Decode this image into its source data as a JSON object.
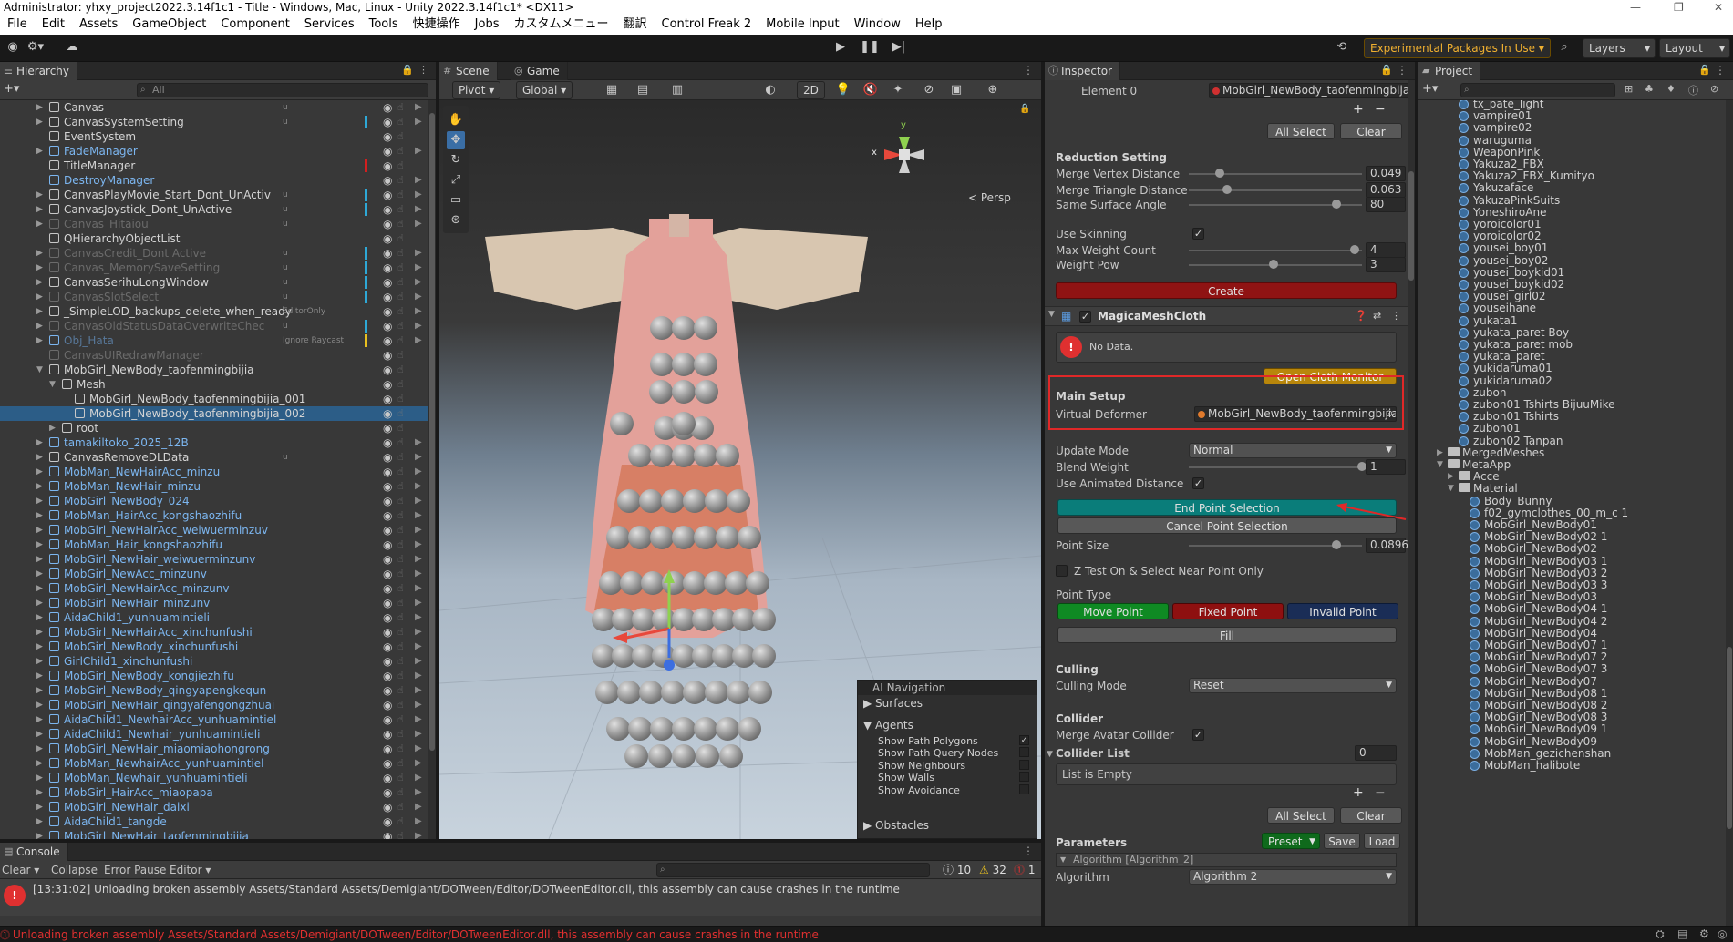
{
  "window": {
    "title": "Administrator: yhxy_project2022.3.14f1c1 - Title - Windows, Mac, Linux - Unity 2022.3.14f1c1* <DX11>"
  },
  "menu": [
    "File",
    "Edit",
    "Assets",
    "GameObject",
    "Component",
    "Services",
    "Tools",
    "快捷操作",
    "Jobs",
    "カスタムメニュー",
    "翻訳",
    "Control Freak 2",
    "Mobile Input",
    "Window",
    "Help"
  ],
  "toolbar": {
    "experimental": "Experimental Packages In Use ▾",
    "layers": "Layers",
    "layout": "Layout"
  },
  "hierarchy": {
    "tab": "Hierarchy",
    "search_placeholder": "All",
    "rows": [
      {
        "name": "Canvas",
        "indent": 0,
        "arrow": "▶",
        "color": "white",
        "u": "u",
        "bar": "",
        "rt": "▶"
      },
      {
        "name": "CanvasSystemSetting",
        "indent": 0,
        "arrow": "▶",
        "color": "white",
        "u": "u",
        "bar": "#2ea8d6",
        "rt": "▶"
      },
      {
        "name": "EventSystem",
        "indent": 0,
        "arrow": "",
        "color": "white",
        "u": "",
        "bar": "",
        "rt": ""
      },
      {
        "name": "FadeManager",
        "indent": 0,
        "arrow": "▶",
        "color": "blue",
        "u": "",
        "bar": "",
        "rt": "▶"
      },
      {
        "name": "TitleManager",
        "indent": 0,
        "arrow": "",
        "color": "white",
        "u": "",
        "bar": "#d21f1f",
        "rt": ""
      },
      {
        "name": "DestroyManager",
        "indent": 0,
        "arrow": "",
        "color": "blue",
        "u": "",
        "bar": "",
        "rt": "▶"
      },
      {
        "name": "CanvasPlayMovie_Start_Dont_UnActiv",
        "indent": 0,
        "arrow": "▶",
        "color": "white",
        "u": "u",
        "bar": "#2ea8d6",
        "rt": "▶"
      },
      {
        "name": "CanvasJoystick_Dont_UnActive",
        "indent": 0,
        "arrow": "▶",
        "color": "white",
        "u": "u",
        "bar": "#2ea8d6",
        "rt": "▶"
      },
      {
        "name": "Canvas_Hitaiou",
        "indent": 0,
        "arrow": "▶",
        "color": "dim",
        "u": "u",
        "bar": "",
        "rt": "▶"
      },
      {
        "name": "QHierarchyObjectList",
        "indent": 0,
        "arrow": "",
        "color": "white",
        "u": "",
        "bar": "",
        "rt": ""
      },
      {
        "name": "CanvasCredit_Dont Active",
        "indent": 0,
        "arrow": "▶",
        "color": "dim",
        "u": "u",
        "bar": "#2ea8d6",
        "rt": "▶"
      },
      {
        "name": "Canvas_MemorySaveSetting",
        "indent": 0,
        "arrow": "▶",
        "color": "dim",
        "u": "u",
        "bar": "#2ea8d6",
        "rt": "▶"
      },
      {
        "name": "CanvasSerihuLongWindow",
        "indent": 0,
        "arrow": "▶",
        "color": "white",
        "u": "u",
        "bar": "#2ea8d6",
        "rt": "▶"
      },
      {
        "name": "CanvasSlotSelect",
        "indent": 0,
        "arrow": "▶",
        "color": "dim",
        "u": "u",
        "bar": "#2ea8d6",
        "rt": "▶"
      },
      {
        "name": "_SimpleLOD_backups_delete_when_ready",
        "indent": 0,
        "arrow": "▶",
        "color": "white",
        "u": "EditorOnly",
        "bar": "",
        "rt": "▶"
      },
      {
        "name": "CanvasOldStatusDataOverwriteChec",
        "indent": 0,
        "arrow": "▶",
        "color": "dim",
        "u": "u",
        "bar": "#2ea8d6",
        "rt": "▶"
      },
      {
        "name": "Obj_Hata",
        "indent": 0,
        "arrow": "▶",
        "color": "dimblue",
        "u": "Ignore Raycast",
        "bar": "#e8c020",
        "rt": "▶"
      },
      {
        "name": "CanvasUIRedrawManager",
        "indent": 0,
        "arrow": "",
        "color": "dim",
        "u": "",
        "bar": "",
        "rt": ""
      },
      {
        "name": "MobGirl_NewBody_taofenmingbijia",
        "indent": 0,
        "arrow": "▼",
        "color": "white",
        "u": "",
        "bar": "",
        "rt": ""
      },
      {
        "name": "Mesh",
        "indent": 1,
        "arrow": "▼",
        "color": "white",
        "u": "",
        "bar": "",
        "rt": ""
      },
      {
        "name": "MobGirl_NewBody_taofenmingbijia_001",
        "indent": 2,
        "arrow": "",
        "color": "white",
        "u": "",
        "bar": "",
        "rt": ""
      },
      {
        "name": "MobGirl_NewBody_taofenmingbijia_002",
        "indent": 2,
        "arrow": "",
        "color": "white",
        "u": "",
        "bar": "",
        "rt": "",
        "selected": true
      },
      {
        "name": "root",
        "indent": 1,
        "arrow": "▶",
        "color": "white",
        "u": "",
        "bar": "",
        "rt": ""
      },
      {
        "name": "tamakiltoko_2025_12B",
        "indent": 0,
        "arrow": "▶",
        "color": "blue",
        "u": "",
        "bar": "",
        "rt": "▶"
      },
      {
        "name": "CanvasRemoveDLData",
        "indent": 0,
        "arrow": "▶",
        "color": "white",
        "u": "u",
        "bar": "",
        "rt": "▶"
      },
      {
        "name": "MobMan_NewHairAcc_minzu",
        "indent": 0,
        "arrow": "▶",
        "color": "blue",
        "u": "",
        "bar": "",
        "rt": "▶"
      },
      {
        "name": "MobMan_NewHair_minzu",
        "indent": 0,
        "arrow": "▶",
        "color": "blue",
        "u": "",
        "bar": "",
        "rt": "▶"
      },
      {
        "name": "MobGirl_NewBody_024",
        "indent": 0,
        "arrow": "▶",
        "color": "blue",
        "u": "",
        "bar": "",
        "rt": "▶"
      },
      {
        "name": "MobMan_HairAcc_kongshaozhifu",
        "indent": 0,
        "arrow": "▶",
        "color": "blue",
        "u": "",
        "bar": "",
        "rt": "▶"
      },
      {
        "name": "MobGirl_NewHairAcc_weiwuerminzuv",
        "indent": 0,
        "arrow": "▶",
        "color": "blue",
        "u": "",
        "bar": "",
        "rt": "▶"
      },
      {
        "name": "MobMan_Hair_kongshaozhifu",
        "indent": 0,
        "arrow": "▶",
        "color": "blue",
        "u": "",
        "bar": "",
        "rt": "▶"
      },
      {
        "name": "MobGirl_NewHair_weiwuerminzunv",
        "indent": 0,
        "arrow": "▶",
        "color": "blue",
        "u": "",
        "bar": "",
        "rt": "▶"
      },
      {
        "name": "MobGirl_NewAcc_minzunv",
        "indent": 0,
        "arrow": "▶",
        "color": "blue",
        "u": "",
        "bar": "",
        "rt": "▶"
      },
      {
        "name": "MobGirl_NewHairAcc_minzunv",
        "indent": 0,
        "arrow": "▶",
        "color": "blue",
        "u": "",
        "bar": "",
        "rt": "▶"
      },
      {
        "name": "MobGirl_NewHair_minzunv",
        "indent": 0,
        "arrow": "▶",
        "color": "blue",
        "u": "",
        "bar": "",
        "rt": "▶"
      },
      {
        "name": "AidaChild1_yunhuamintieli",
        "indent": 0,
        "arrow": "▶",
        "color": "blue",
        "u": "",
        "bar": "",
        "rt": "▶"
      },
      {
        "name": "MobGirl_NewHairAcc_xinchunfushi",
        "indent": 0,
        "arrow": "▶",
        "color": "blue",
        "u": "",
        "bar": "",
        "rt": "▶"
      },
      {
        "name": "MobGirl_NewBody_xinchunfushi",
        "indent": 0,
        "arrow": "▶",
        "color": "blue",
        "u": "",
        "bar": "",
        "rt": "▶"
      },
      {
        "name": "GirlChild1_xinchunfushi",
        "indent": 0,
        "arrow": "▶",
        "color": "blue",
        "u": "",
        "bar": "",
        "rt": "▶"
      },
      {
        "name": "MobGirl_NewBody_kongjiezhifu",
        "indent": 0,
        "arrow": "▶",
        "color": "blue",
        "u": "",
        "bar": "",
        "rt": "▶"
      },
      {
        "name": "MobGirl_NewBody_qingyapengkequn",
        "indent": 0,
        "arrow": "▶",
        "color": "blue",
        "u": "",
        "bar": "",
        "rt": "▶"
      },
      {
        "name": "MobGirl_NewHair_qingyafengongzhuai",
        "indent": 0,
        "arrow": "▶",
        "color": "blue",
        "u": "",
        "bar": "",
        "rt": "▶"
      },
      {
        "name": "AidaChild1_NewhairAcc_yunhuamintiel",
        "indent": 0,
        "arrow": "▶",
        "color": "blue",
        "u": "",
        "bar": "",
        "rt": "▶"
      },
      {
        "name": "AidaChild1_Newhair_yunhuamintieli",
        "indent": 0,
        "arrow": "▶",
        "color": "blue",
        "u": "",
        "bar": "",
        "rt": "▶"
      },
      {
        "name": "MobGirl_NewHair_miaomiaohongrong",
        "indent": 0,
        "arrow": "▶",
        "color": "blue",
        "u": "",
        "bar": "",
        "rt": "▶"
      },
      {
        "name": "MobMan_NewhairAcc_yunhuamintiel",
        "indent": 0,
        "arrow": "▶",
        "color": "blue",
        "u": "",
        "bar": "",
        "rt": "▶"
      },
      {
        "name": "MobMan_Newhair_yunhuamintieli",
        "indent": 0,
        "arrow": "▶",
        "color": "blue",
        "u": "",
        "bar": "",
        "rt": "▶"
      },
      {
        "name": "MobGirl_HairAcc_miaopapa",
        "indent": 0,
        "arrow": "▶",
        "color": "blue",
        "u": "",
        "bar": "",
        "rt": "▶"
      },
      {
        "name": "MobGirl_NewHair_daixi",
        "indent": 0,
        "arrow": "▶",
        "color": "blue",
        "u": "",
        "bar": "",
        "rt": "▶"
      },
      {
        "name": "AidaChild1_tangde",
        "indent": 0,
        "arrow": "▶",
        "color": "blue",
        "u": "",
        "bar": "",
        "rt": "▶"
      },
      {
        "name": "MobGirl_NewHair_taofenmingbijia",
        "indent": 0,
        "arrow": "▶",
        "color": "blue",
        "u": "",
        "bar": "",
        "rt": "▶"
      }
    ]
  },
  "scene": {
    "tab_scene": "Scene",
    "tab_game": "Game",
    "pivot": "Pivot",
    "global": "Global",
    "mode_2d": "2D",
    "persp": "< Persp",
    "gizmo_x": "x",
    "gizmo_y": "y",
    "ai_nav": {
      "title": "AI Navigation",
      "surfaces": "Surfaces",
      "agents": "Agents",
      "items": [
        "Show Path Polygons",
        "Show Path Query Nodes",
        "Show Neighbours",
        "Show Walls",
        "Show Avoidance"
      ],
      "checked_item": "✓",
      "obstacles": "Obstacles"
    }
  },
  "inspector": {
    "tab": "Inspector",
    "element0_label": "Element 0",
    "element0_value": "MobGirl_NewBody_taofenmingbija",
    "all_select": "All Select",
    "clear": "Clear",
    "reduction_title": "Reduction Setting",
    "merge_vertex": {
      "label": "Merge Vertex Distance",
      "value": "0.049",
      "frac": 0.18
    },
    "merge_triangle": {
      "label": "Merge Triangle Distance",
      "value": "0.063",
      "frac": 0.22
    },
    "same_surface": {
      "label": "Same Surface Angle",
      "value": "80",
      "frac": 0.85
    },
    "use_skinning": "Use Skinning",
    "max_weight": {
      "label": "Max Weight Count",
      "value": "4",
      "frac": 0.96
    },
    "weight_pow": {
      "label": "Weight Pow",
      "value": "3",
      "frac": 0.49
    },
    "create": "Create",
    "component_title": "MagicaMeshCloth",
    "no_data": "No Data.",
    "open_monitor": "Open Cloth Monitor",
    "main_setup": "Main Setup",
    "virtual_deformer_label": "Virtual Deformer",
    "virtual_deformer_value": "MobGirl_NewBody_taofenmingbijia_(",
    "update_mode_label": "Update Mode",
    "update_mode_value": "Normal",
    "blend_weight": {
      "label": "Blend Weight",
      "value": "1",
      "frac": 1.0
    },
    "use_animated": "Use Animated Distance",
    "end_point": "End Point Selection",
    "cancel_point": "Cancel Point Selection",
    "point_size": {
      "label": "Point Size",
      "value": "0.0896",
      "frac": 0.85
    },
    "z_test": "Z Test On & Select Near Point Only",
    "point_type": "Point Type",
    "move_point": "Move Point",
    "fixed_point": "Fixed Point",
    "invalid_point": "Invalid Point",
    "fill": "Fill",
    "culling_title": "Culling",
    "culling_mode_label": "Culling Mode",
    "culling_mode_value": "Reset",
    "collider_title": "Collider",
    "merge_avatar": "Merge Avatar Collider",
    "collider_list": "Collider List",
    "collider_count": "0",
    "list_empty": "List is Empty",
    "parameters": "Parameters",
    "preset": "Preset",
    "save": "Save",
    "load": "Load",
    "algorithm": "Algorithm [Algorithm_2]",
    "algorithm_row": "Algorithm",
    "algorithm_value": "Algorithm 2",
    "plus": "+",
    "minus": "−"
  },
  "project": {
    "tab": "Project",
    "rows": [
      {
        "name": "tx_pate_light",
        "indent": 2,
        "type": "asset"
      },
      {
        "name": "vampire01",
        "indent": 2,
        "type": "asset"
      },
      {
        "name": "vampire02",
        "indent": 2,
        "type": "asset"
      },
      {
        "name": "waruguma",
        "indent": 2,
        "type": "asset"
      },
      {
        "name": "WeaponPink",
        "indent": 2,
        "type": "asset"
      },
      {
        "name": "Yakuza2_FBX",
        "indent": 2,
        "type": "asset"
      },
      {
        "name": "Yakuza2_FBX_Kumityo",
        "indent": 2,
        "type": "asset"
      },
      {
        "name": "Yakuzaface",
        "indent": 2,
        "type": "asset"
      },
      {
        "name": "YakuzaPinkSuits",
        "indent": 2,
        "type": "asset"
      },
      {
        "name": "YoneshiroAne",
        "indent": 2,
        "type": "asset"
      },
      {
        "name": "yoroicolor01",
        "indent": 2,
        "type": "asset"
      },
      {
        "name": "yoroicolor02",
        "indent": 2,
        "type": "asset"
      },
      {
        "name": "yousei_boy01",
        "indent": 2,
        "type": "asset"
      },
      {
        "name": "yousei_boy02",
        "indent": 2,
        "type": "asset"
      },
      {
        "name": "yousei_boykid01",
        "indent": 2,
        "type": "asset"
      },
      {
        "name": "yousei_boykid02",
        "indent": 2,
        "type": "asset"
      },
      {
        "name": "yousei_girl02",
        "indent": 2,
        "type": "asset"
      },
      {
        "name": "youseihane",
        "indent": 2,
        "type": "asset"
      },
      {
        "name": "yukata1",
        "indent": 2,
        "type": "asset"
      },
      {
        "name": "yukata_paret Boy",
        "indent": 2,
        "type": "asset"
      },
      {
        "name": "yukata_paret mob",
        "indent": 2,
        "type": "asset"
      },
      {
        "name": "yukata_paret",
        "indent": 2,
        "type": "asset"
      },
      {
        "name": "yukidaruma01",
        "indent": 2,
        "type": "asset"
      },
      {
        "name": "yukidaruma02",
        "indent": 2,
        "type": "asset"
      },
      {
        "name": "zubon",
        "indent": 2,
        "type": "asset"
      },
      {
        "name": "zubon01 Tshirts BijuuMike",
        "indent": 2,
        "type": "asset"
      },
      {
        "name": "zubon01 Tshirts",
        "indent": 2,
        "type": "asset"
      },
      {
        "name": "zubon01",
        "indent": 2,
        "type": "asset"
      },
      {
        "name": "zubon02 Tanpan",
        "indent": 2,
        "type": "asset"
      },
      {
        "name": "MergedMeshes",
        "indent": 1,
        "type": "folder",
        "arrow": "▶"
      },
      {
        "name": "MetaApp",
        "indent": 1,
        "type": "folder",
        "arrow": "▼"
      },
      {
        "name": "Acce",
        "indent": 2,
        "type": "folder",
        "arrow": "▶"
      },
      {
        "name": "Material",
        "indent": 2,
        "type": "folder",
        "arrow": "▼"
      },
      {
        "name": "Body_Bunny",
        "indent": 3,
        "type": "asset"
      },
      {
        "name": "f02_gymclothes_00_m_c 1",
        "indent": 3,
        "type": "asset"
      },
      {
        "name": "MobGirl_NewBody01",
        "indent": 3,
        "type": "asset"
      },
      {
        "name": "MobGirl_NewBody02 1",
        "indent": 3,
        "type": "asset"
      },
      {
        "name": "MobGirl_NewBody02",
        "indent": 3,
        "type": "asset"
      },
      {
        "name": "MobGirl_NewBody03 1",
        "indent": 3,
        "type": "asset"
      },
      {
        "name": "MobGirl_NewBody03 2",
        "indent": 3,
        "type": "asset"
      },
      {
        "name": "MobGirl_NewBody03 3",
        "indent": 3,
        "type": "asset"
      },
      {
        "name": "MobGirl_NewBody03",
        "indent": 3,
        "type": "asset"
      },
      {
        "name": "MobGirl_NewBody04 1",
        "indent": 3,
        "type": "asset"
      },
      {
        "name": "MobGirl_NewBody04 2",
        "indent": 3,
        "type": "asset"
      },
      {
        "name": "MobGirl_NewBody04",
        "indent": 3,
        "type": "asset"
      },
      {
        "name": "MobGirl_NewBody07 1",
        "indent": 3,
        "type": "asset"
      },
      {
        "name": "MobGirl_NewBody07 2",
        "indent": 3,
        "type": "asset"
      },
      {
        "name": "MobGirl_NewBody07 3",
        "indent": 3,
        "type": "asset"
      },
      {
        "name": "MobGirl_NewBody07",
        "indent": 3,
        "type": "asset"
      },
      {
        "name": "MobGirl_NewBody08 1",
        "indent": 3,
        "type": "asset"
      },
      {
        "name": "MobGirl_NewBody08 2",
        "indent": 3,
        "type": "asset"
      },
      {
        "name": "MobGirl_NewBody08 3",
        "indent": 3,
        "type": "asset"
      },
      {
        "name": "MobGirl_NewBody09 1",
        "indent": 3,
        "type": "asset"
      },
      {
        "name": "MobGirl_NewBody09",
        "indent": 3,
        "type": "asset"
      },
      {
        "name": "MobMan_gezichenshan",
        "indent": 3,
        "type": "asset"
      },
      {
        "name": "MobMan_halibote",
        "indent": 3,
        "type": "asset"
      }
    ]
  },
  "console": {
    "tab": "Console",
    "clear": "Clear",
    "collapse": "Collapse",
    "error_pause": "Error Pause",
    "editor": "Editor",
    "count_info": "10",
    "count_warn": "32",
    "count_err": "1",
    "message": "[13:31:02] Unloading broken assembly Assets/Standard Assets/Demigiant/DOTween/Editor/DOTweenEditor.dll, this assembly can cause crashes in the runtime"
  },
  "statusbar": {
    "message": "Unloading broken assembly Assets/Standard Assets/Demigiant/DOTween/Editor/DOTweenEditor.dll, this assembly can cause crashes in the runtime"
  },
  "colors": {
    "accent_blue": "#2c5d87",
    "create_red": "#8f1313",
    "highlight_red": "#e02828",
    "end_point_teal": "#0a7d7a",
    "move_green": "#0f8a23",
    "fixed_red": "#8e1010",
    "invalid_navy": "#1a2d56"
  }
}
